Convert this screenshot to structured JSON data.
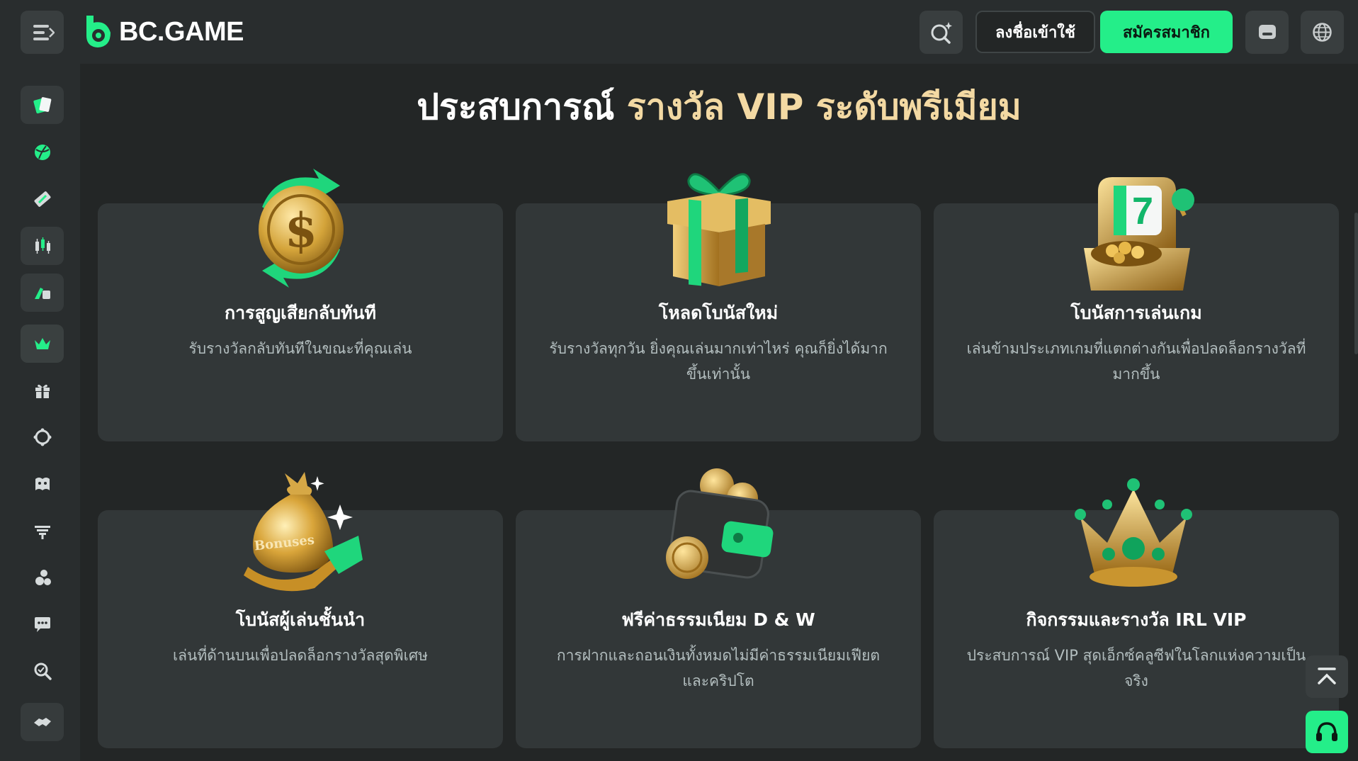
{
  "header": {
    "logo_text": "BC.GAME",
    "login_label": "ลงชื่อเข้าใช้",
    "signup_label": "สมัครสมาชิก",
    "accent_color": "#24ee89"
  },
  "sidebar": {
    "items": [
      {
        "icon": "casino-cards-icon"
      },
      {
        "icon": "sports-ball-icon"
      },
      {
        "icon": "lottery-ticket-icon"
      },
      {
        "icon": "trading-candles-icon"
      },
      {
        "icon": "racing-icon"
      },
      {
        "icon": "vip-crown-icon",
        "active": true
      },
      {
        "icon": "gift-icon"
      },
      {
        "icon": "affiliate-gear-icon"
      },
      {
        "icon": "quest-icon"
      },
      {
        "icon": "leaderboard-icon"
      },
      {
        "icon": "sponsorship-icon"
      },
      {
        "icon": "chat-bubble-icon"
      },
      {
        "icon": "provably-fair-icon"
      },
      {
        "icon": "partners-handshake-icon"
      }
    ]
  },
  "main": {
    "heading_white": "ประสบการณ์",
    "heading_gold": "รางวัล VIP ระดับพรีเมียม",
    "heading_gold_color": "#f3d9a3",
    "cards": [
      {
        "icon": "rakeback-coin-icon",
        "title": "การสูญเสียกลับทันที",
        "desc": "รับรางวัลกลับทันทีในขณะที่คุณเล่น"
      },
      {
        "icon": "reload-gift-icon",
        "title": "โหลดโบนัสใหม่",
        "desc": "รับรางวัลทุกวัน ยิ่งคุณเล่นมากเท่าไหร่ คุณก็ยิ่งได้มากขึ้นเท่านั้น"
      },
      {
        "icon": "slot-machine-icon",
        "title": "โบนัสการเล่นเกม",
        "desc": "เล่นข้ามประเภทเกมที่แตกต่างกันเพื่อปลดล็อกรางวัลที่มากขึ้น"
      },
      {
        "icon": "bonus-bag-icon",
        "title": "โบนัสผู้เล่นชั้นนำ",
        "desc": "เล่นที่ด้านบนเพื่อปลดล็อกรางวัลสุดพิเศษ",
        "icon_text": "Bonuses"
      },
      {
        "icon": "wallet-coins-icon",
        "title": "ฟรีค่าธรรมเนียม D & W",
        "desc": "การฝากและถอนเงินทั้งหมดไม่มีค่าธรรมเนียมเฟียต และคริปโต"
      },
      {
        "icon": "gold-crown-icon",
        "title": "กิจกรรมและรางวัล IRL VIP",
        "desc": "ประสบการณ์ VIP สุดเอ็กซ์คลูซีฟในโลกแห่งความเป็นจริง"
      }
    ]
  }
}
